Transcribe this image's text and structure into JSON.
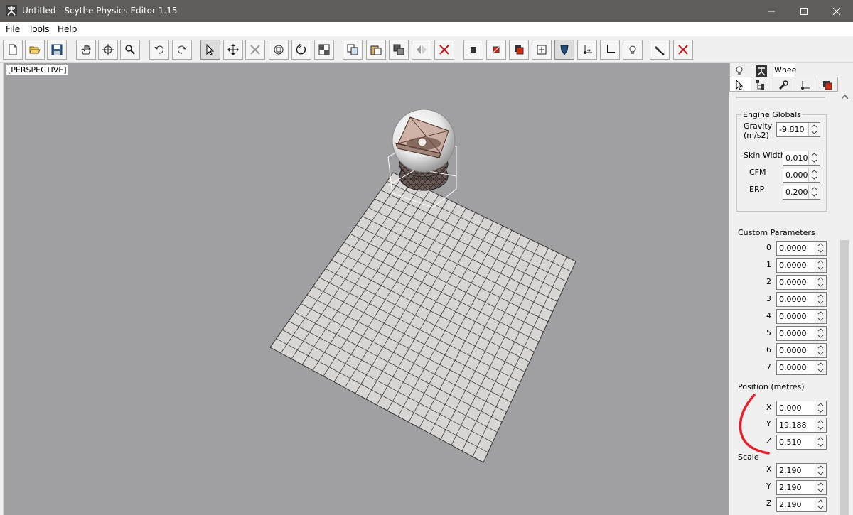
{
  "window": {
    "title": "Untitled - Scythe Physics Editor 1.15",
    "app_icon": "scythe-logo-icon"
  },
  "menu": [
    "File",
    "Tools",
    "Help"
  ],
  "viewport": {
    "label": "[PERSPECTIVE]"
  },
  "panel": {
    "tabs_top": {
      "wheel_label": "Whee"
    },
    "engine_globals": {
      "title": "Engine Globals",
      "gravity_label_1": "Gravity",
      "gravity_label_2": "(m/s2)",
      "gravity": "-9.810",
      "skin_width_label": "Skin Width",
      "skin_width": "0.010",
      "cfm_label": "CFM",
      "cfm": "0.000",
      "erp_label": "ERP",
      "erp": "0.200"
    },
    "custom_params": {
      "title": "Custom Parameters",
      "items": [
        {
          "index": "0",
          "value": "0.0000"
        },
        {
          "index": "1",
          "value": "0.0000"
        },
        {
          "index": "2",
          "value": "0.0000"
        },
        {
          "index": "3",
          "value": "0.0000"
        },
        {
          "index": "4",
          "value": "0.0000"
        },
        {
          "index": "5",
          "value": "0.0000"
        },
        {
          "index": "6",
          "value": "0.0000"
        },
        {
          "index": "7",
          "value": "0.0000"
        }
      ]
    },
    "position": {
      "title": "Position (metres)",
      "x_label": "X",
      "x": "0.000",
      "y_label": "Y",
      "y": "19.188",
      "z_label": "Z",
      "z": "0.510"
    },
    "scale": {
      "title": "Scale",
      "x_label": "X",
      "x": "2.190",
      "y_label": "Y",
      "y": "2.190",
      "z_label": "Z",
      "z": "2.190"
    }
  },
  "colors": {
    "titlebar": "#5f5d5c",
    "viewport_bg": "#a0a0a2",
    "grid_fill": "#d8d6d4",
    "annotation": "#e8202a"
  }
}
